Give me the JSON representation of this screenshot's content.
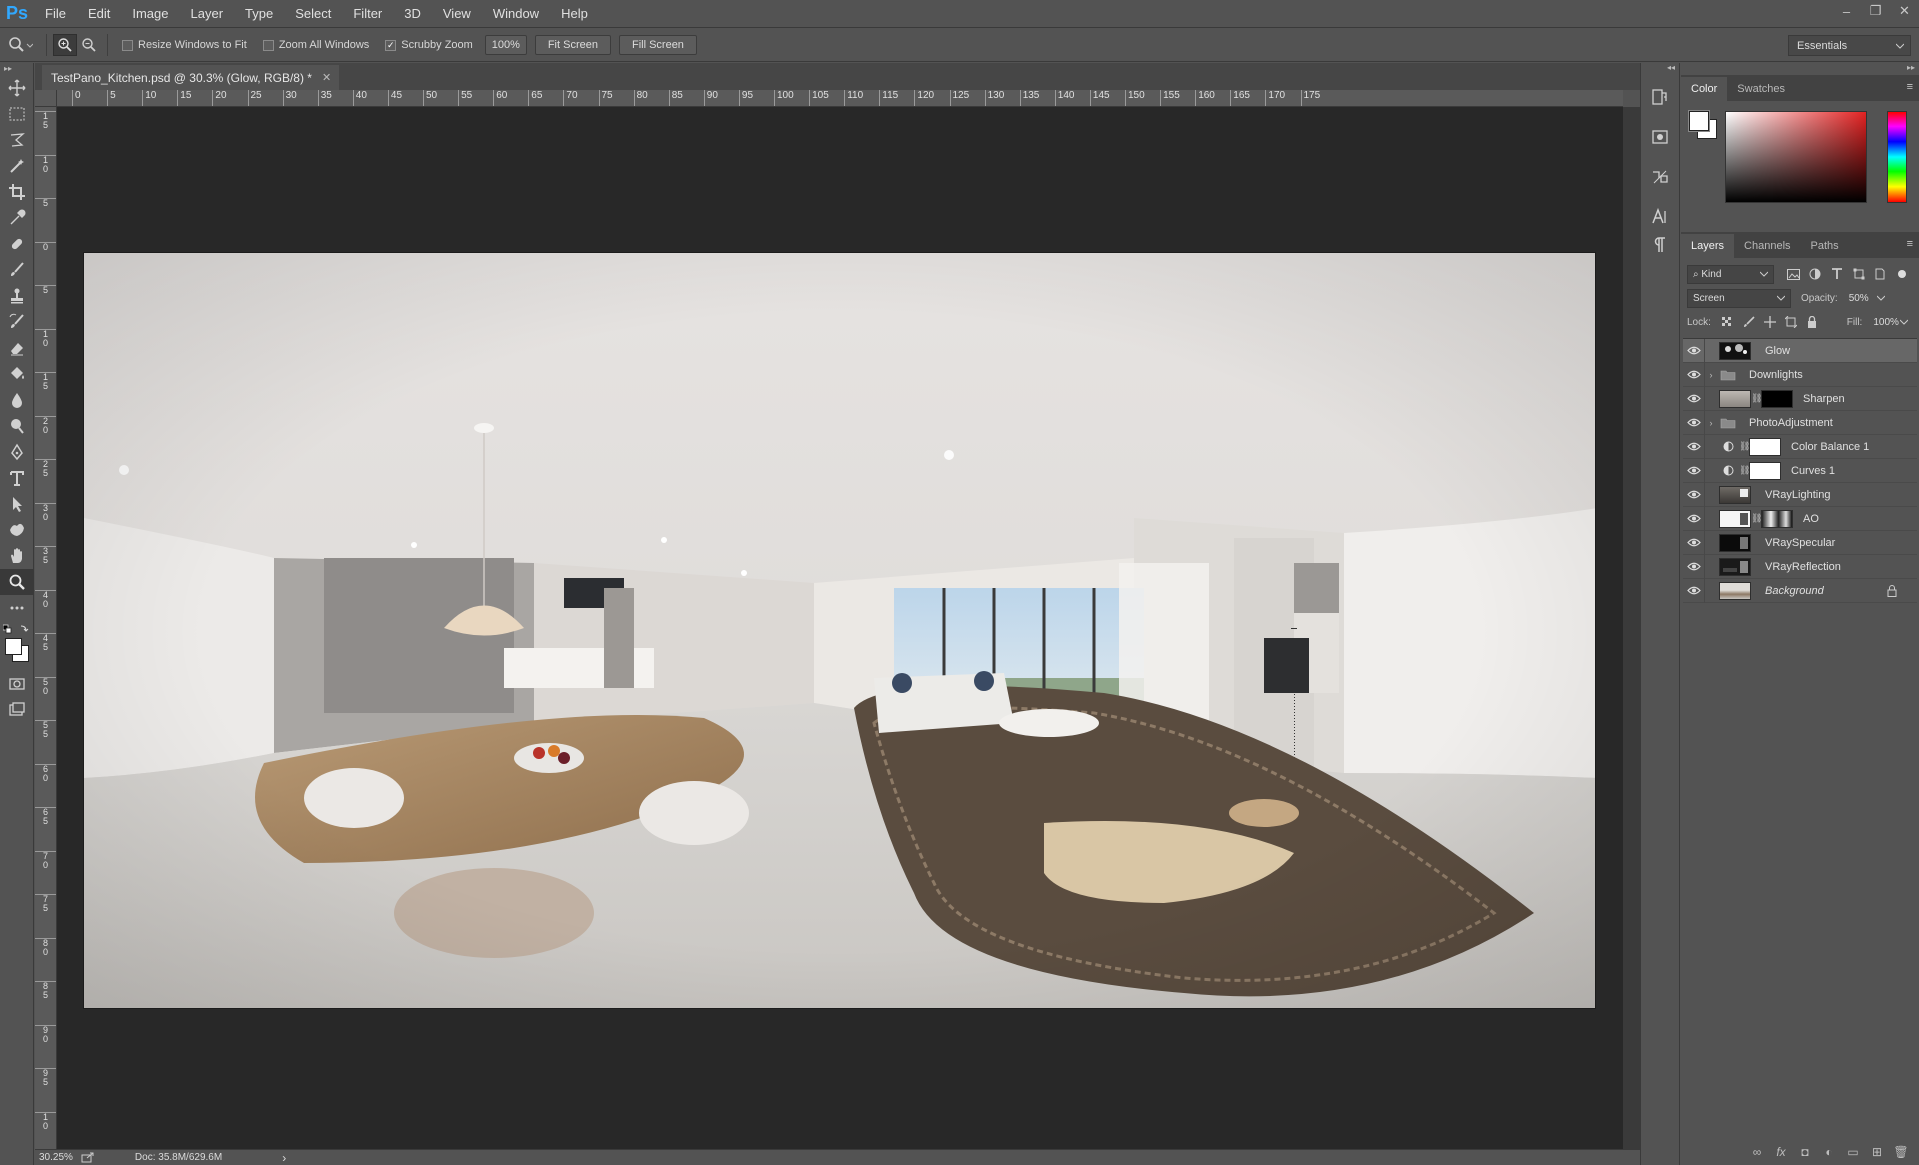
{
  "app": {
    "logo": "Ps",
    "menu": [
      "File",
      "Edit",
      "Image",
      "Layer",
      "Type",
      "Select",
      "Filter",
      "3D",
      "View",
      "Window",
      "Help"
    ],
    "window_controls": {
      "minimize": "–",
      "restore": "❐",
      "close": "✕"
    }
  },
  "options_bar": {
    "resize_windows_label": "Resize Windows to Fit",
    "resize_windows_checked": false,
    "zoom_all_label": "Zoom All Windows",
    "zoom_all_checked": false,
    "scrubby_label": "Scrubby Zoom",
    "scrubby_checked": true,
    "zoom_value": "100%",
    "fit_screen": "Fit Screen",
    "fill_screen": "Fill Screen",
    "workspace": "Essentials"
  },
  "document": {
    "tab_title": "TestPano_Kitchen.psd @ 30.3% (Glow, RGB/8) *",
    "tab_close": "✕",
    "ruler_h": [
      "0",
      "5",
      "10",
      "15",
      "20",
      "25",
      "30",
      "35",
      "40",
      "45",
      "50",
      "55",
      "60",
      "65",
      "70",
      "75",
      "80",
      "85",
      "90",
      "95",
      "100",
      "105",
      "110",
      "115",
      "120",
      "125",
      "130",
      "135",
      "140",
      "145",
      "150",
      "155",
      "160",
      "165",
      "170",
      "175"
    ],
    "ruler_v": [
      "1\n5",
      "1\n0",
      "5",
      "0",
      "5",
      "1\n0",
      "1\n5",
      "2\n0",
      "2\n5",
      "3\n0",
      "3\n5",
      "4\n0",
      "4\n5",
      "5\n0",
      "5\n5",
      "6\n0",
      "6\n5",
      "7\n0",
      "7\n5",
      "8\n0",
      "8\n5",
      "9\n0",
      "9\n5",
      "1\n0"
    ]
  },
  "status": {
    "zoom": "30.25%",
    "doc": "Doc: 35.8M/629.6M",
    "arrow": "›"
  },
  "color_panel": {
    "tabs": [
      "Color",
      "Swatches"
    ],
    "foreground": "#ffffff",
    "background": "#ffffff"
  },
  "layers_panel": {
    "tabs": [
      "Layers",
      "Channels",
      "Paths"
    ],
    "filter_kind": "Kind",
    "blend_mode": "Screen",
    "opacity_label": "Opacity:",
    "opacity": "50%",
    "lock_label": "Lock:",
    "fill_label": "Fill:",
    "fill": "100%",
    "layers": [
      {
        "name": "Glow",
        "type": "pixel",
        "selected": true
      },
      {
        "name": "Downlights",
        "type": "group"
      },
      {
        "name": "Sharpen",
        "type": "masked"
      },
      {
        "name": "PhotoAdjustment",
        "type": "group"
      },
      {
        "name": "Color Balance 1",
        "type": "adjustment"
      },
      {
        "name": "Curves 1",
        "type": "adjustment"
      },
      {
        "name": "VRayLighting",
        "type": "pixel"
      },
      {
        "name": "AO",
        "type": "masked"
      },
      {
        "name": "VRaySpecular",
        "type": "pixel"
      },
      {
        "name": "VRayReflection",
        "type": "pixel"
      },
      {
        "name": "Background",
        "type": "background"
      }
    ],
    "footer": [
      "∞",
      "fx",
      "◘",
      "◐",
      "▭",
      "⊞",
      "🗑"
    ]
  },
  "colors": {
    "accent": "#31a8ff",
    "canvas": "#282828",
    "panel": "#535353"
  }
}
